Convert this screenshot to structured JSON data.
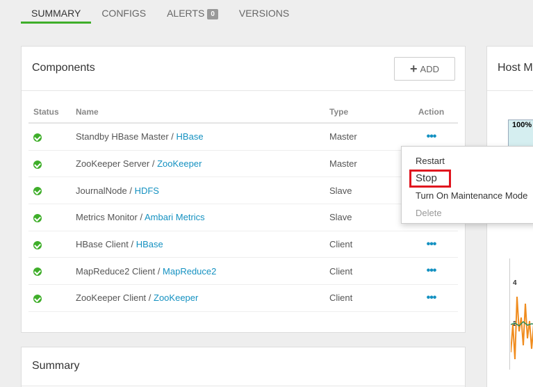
{
  "tabs": [
    {
      "label": "SUMMARY"
    },
    {
      "label": "CONFIGS"
    },
    {
      "label": "ALERTS",
      "badge": "0"
    },
    {
      "label": "VERSIONS"
    }
  ],
  "components_card": {
    "title": "Components",
    "add_label": "ADD",
    "columns": {
      "status": "Status",
      "name": "Name",
      "type": "Type",
      "action": "Action"
    },
    "rows": [
      {
        "name": "Standby HBase Master",
        "service": "HBase",
        "type": "Master"
      },
      {
        "name": "ZooKeeper Server",
        "service": "ZooKeeper",
        "type": "Master"
      },
      {
        "name": "JournalNode",
        "service": "HDFS",
        "type": "Slave"
      },
      {
        "name": "Metrics Monitor",
        "service": "Ambari Metrics",
        "type": "Slave"
      },
      {
        "name": "HBase Client",
        "service": "HBase",
        "type": "Client"
      },
      {
        "name": "MapReduce2 Client",
        "service": "MapReduce2",
        "type": "Client"
      },
      {
        "name": "ZooKeeper Client",
        "service": "ZooKeeper",
        "type": "Client"
      }
    ]
  },
  "action_menu": {
    "items": [
      "Restart",
      "Stop",
      "Turn On Maintenance Mode",
      "Delete"
    ]
  },
  "summary_card": {
    "title": "Summary"
  },
  "host_metrics": {
    "title": "Host Metrics",
    "label_top": "100%",
    "y4": "4",
    "y2": "2"
  },
  "colors": {
    "accent": "#3fae2a",
    "link": "#1491c1",
    "highlight": "#e0141e",
    "series": "#f08c1e"
  }
}
